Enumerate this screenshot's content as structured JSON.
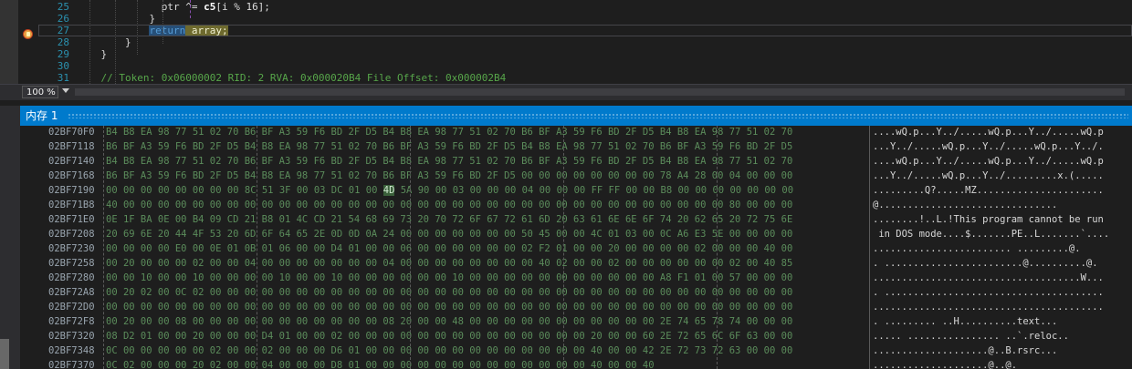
{
  "editor": {
    "lines": [
      {
        "num": "25",
        "indent": "              ",
        "parts": [
          {
            "text": "ptr ^= "
          },
          {
            "text": "c5",
            "cls": "bold"
          },
          {
            "text": "[i % 16];"
          }
        ]
      },
      {
        "num": "26",
        "indent": "            ",
        "parts": [
          {
            "text": "}"
          }
        ]
      },
      {
        "num": "27",
        "indent": "            ",
        "parts": [
          {
            "text": "return",
            "cls": "kw-hl"
          },
          {
            "text": " array;",
            "cls": "ret-hl"
          }
        ],
        "current": true
      },
      {
        "num": "28",
        "indent": "        ",
        "parts": [
          {
            "text": "}"
          }
        ]
      },
      {
        "num": "29",
        "indent": "    ",
        "parts": [
          {
            "text": "}"
          }
        ]
      },
      {
        "num": "30",
        "indent": "",
        "parts": [
          {
            "text": ""
          }
        ]
      },
      {
        "num": "31",
        "indent": "    ",
        "parts": [
          {
            "text": "// Token: 0x06000002 RID: 2 RVA: 0x000020B4 File Offset: 0x000002B4",
            "cls": "comment"
          }
        ]
      }
    ],
    "zoom_label": "100 %"
  },
  "memory": {
    "title": "内存 1",
    "rows": [
      {
        "addr": "02BF70F0",
        "hex": "B4 B8 EA 98 77 51 02 70 B6 BF A3 59 F6 BD 2F D5 B4 B8 EA 98 77 51 02 70 B6 BF A3 59 F6 BD 2F D5 B4 B8 EA 98 77 51 02 70",
        "ascii": "....wQ.p...Y../.....wQ.p...Y../.....wQ.p"
      },
      {
        "addr": "02BF7118",
        "hex": "B6 BF A3 59 F6 BD 2F D5 B4 B8 EA 98 77 51 02 70 B6 BF A3 59 F6 BD 2F D5 B4 B8 EA 98 77 51 02 70 B6 BF A3 59 F6 BD 2F D5",
        "ascii": "...Y../.....wQ.p...Y../.....wQ.p...Y../."
      },
      {
        "addr": "02BF7140",
        "hex": "B4 B8 EA 98 77 51 02 70 B6 BF A3 59 F6 BD 2F D5 B4 B8 EA 98 77 51 02 70 B6 BF A3 59 F6 BD 2F D5 B4 B8 EA 98 77 51 02 70",
        "ascii": "....wQ.p...Y../.....wQ.p...Y../.....wQ.p"
      },
      {
        "addr": "02BF7168",
        "hex": "B6 BF A3 59 F6 BD 2F D5 B4 B8 EA 98 77 51 02 70 B6 BF A3 59 F6 BD 2F D5 00 00 00 00 00 00 00 00 78 A4 28 00 04 00 00 00",
        "ascii": "...Y../.....wQ.p...Y../.........x.(....."
      },
      {
        "addr": "02BF7190",
        "hex": "00 00 00 00 00 00 00 00 8C 51 3F 00 03 DC 01 00 4D 5A 90 00 03 00 00 00 04 00 00 00 FF FF 00 00 B8 00 00 00 00 00 00 00",
        "ascii": ".........Q?.....MZ......................",
        "hl": 16
      },
      {
        "addr": "02BF71B8",
        "hex": "40 00 00 00 00 00 00 00 00 00 00 00 00 00 00 00 00 00 00 00 00 00 00 00 00 00 00 00 00 00 00 00 00 00 00 00 80 00 00 00",
        "ascii": "@..............................."
      },
      {
        "addr": "02BF71E0",
        "hex": "0E 1F BA 0E 00 B4 09 CD 21 B8 01 4C CD 21 54 68 69 73 20 70 72 6F 67 72 61 6D 20 63 61 6E 6E 6F 74 20 62 65 20 72 75 6E",
        "ascii": "........!..L.!This program cannot be run"
      },
      {
        "addr": "02BF7208",
        "hex": "20 69 6E 20 44 4F 53 20 6D 6F 64 65 2E 0D 0D 0A 24 00 00 00 00 00 00 00 50 45 00 00 4C 01 03 00 0C A6 E3 5E 00 00 00 00",
        "ascii": " in DOS mode....$.......PE..L.......`...."
      },
      {
        "addr": "02BF7230",
        "hex": "00 00 00 00 E0 00 0E 01 0B 01 06 00 00 D4 01 00 00 06 00 00 00 00 00 00 02 F2 01 00 00 20 00 00 00 00 02 00 00 00 40 00",
        "ascii": "........................ .........@."
      },
      {
        "addr": "02BF7258",
        "hex": "00 20 00 00 00 02 00 00 04 00 00 00 00 00 00 00 04 00 00 00 00 00 00 00 00 40 02 00 00 02 00 00 00 00 00 00 02 00 40 85",
        "ascii": ". ........................@..........@."
      },
      {
        "addr": "02BF7280",
        "hex": "00 00 10 00 00 10 00 00 00 00 10 00 00 10 00 00 00 00 00 00 10 00 00 00 00 00 00 00 00 00 00 00 A8 F1 01 00 57 00 00 00",
        "ascii": "....................................W..."
      },
      {
        "addr": "02BF72A8",
        "hex": "00 20 02 00 0C 02 00 00 00 00 00 00 00 00 00 00 00 00 00 00 00 00 00 00 00 00 00 00 00 00 00 00 00 00 00 00 00 00 00 00",
        "ascii": ". ......................................"
      },
      {
        "addr": "02BF72D0",
        "hex": "00 00 00 00 00 00 00 00 00 00 00 00 00 00 00 00 00 00 00 00 00 00 00 00 00 00 00 00 00 00 00 00 00 00 00 00 00 00 00 00",
        "ascii": "........................................"
      },
      {
        "addr": "02BF72F8",
        "hex": "00 20 00 00 08 00 00 00 00 00 00 00 00 00 00 00 08 20 00 00 48 00 00 00 00 00 00 00 00 00 00 00 2E 74 65 78 74 00 00 00",
        "ascii": ". ......... ..H..........text..."
      },
      {
        "addr": "02BF7320",
        "hex": "08 D2 01 00 00 20 00 00 00 D4 01 00 00 02 00 00 00 00 00 00 00 00 00 00 00 00 00 00 20 00 00 60 2E 72 65 6C 6F 63 00 00",
        "ascii": "..... ................ ..`.reloc.."
      },
      {
        "addr": "02BF7348",
        "hex": "0C 00 00 00 00 00 02 00 00 02 00 00 00 D6 01 00 00 00 00 00 00 00 00 00 00 00 00 00 40 00 00 42 2E 72 73 72 63 00 00 00",
        "ascii": "....................@..B.rsrc..."
      },
      {
        "addr": "02BF7370",
        "hex": "0C 02 00 00 00 20 02 00 00 04 00 00 00 D8 01 00 00 00 00 00 00 00 00 00 00 00 00 00 40 00 00 40",
        "ascii": "....................@..@."
      }
    ]
  }
}
